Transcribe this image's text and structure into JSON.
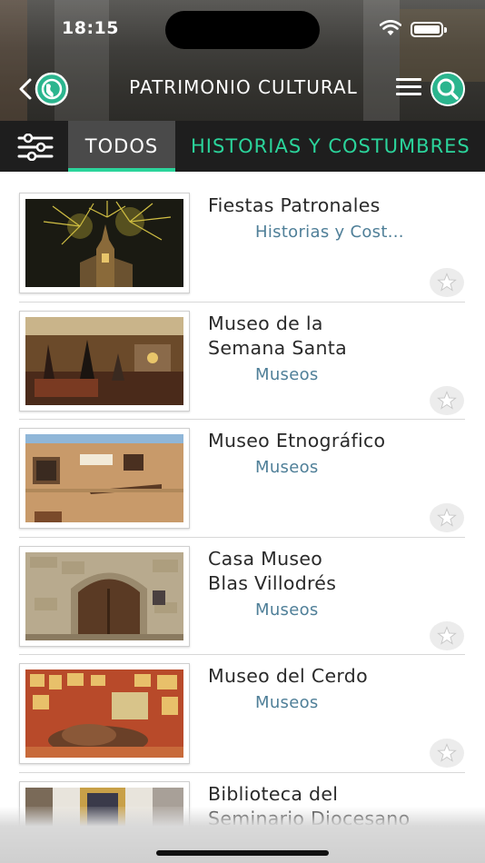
{
  "status_bar": {
    "time": "18:15"
  },
  "nav": {
    "title": "PATRIMONIO CULTURAL"
  },
  "tabs": [
    {
      "label": "TODOS",
      "active": true
    },
    {
      "label": "HISTORIAS Y COSTUMBRES",
      "active": false
    }
  ],
  "colors": {
    "accent": "#2bd49b",
    "category": "#4f7f98",
    "tab_bar": "#1e1e1e"
  },
  "items": [
    {
      "title": "Fiestas Patronales",
      "category": "Historias y Cost..."
    },
    {
      "title": "Museo de la\nSemana Santa",
      "category": "Museos"
    },
    {
      "title": "Museo Etnográfico",
      "category": "Museos"
    },
    {
      "title": "Casa Museo\nBlas Villodrés",
      "category": "Museos"
    },
    {
      "title": "Museo del Cerdo",
      "category": "Museos"
    },
    {
      "title": "Biblioteca del\nSeminario Diocesano",
      "category": ""
    }
  ]
}
